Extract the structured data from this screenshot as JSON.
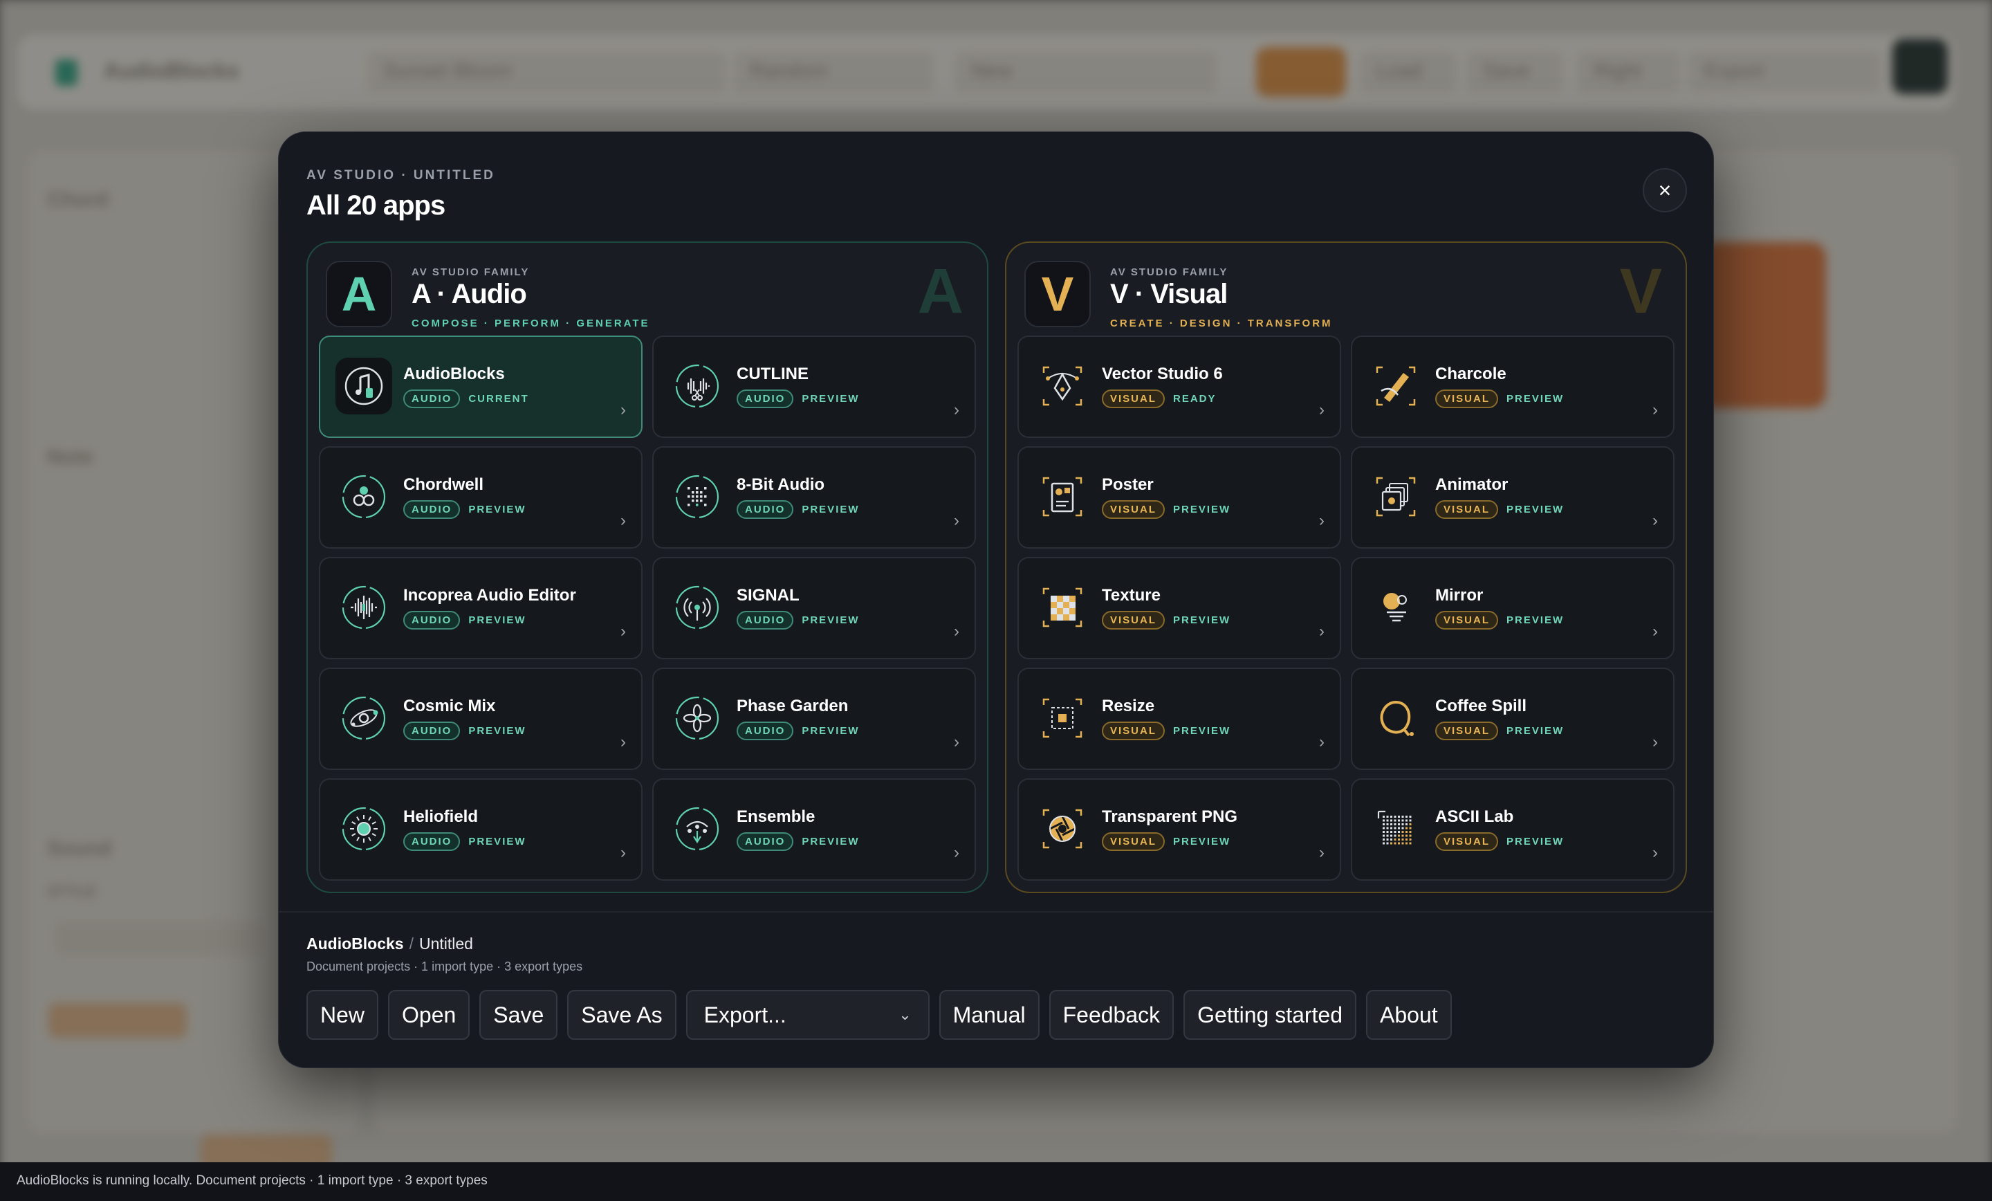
{
  "background": {
    "app_name": "AudioBlocks",
    "preset": "Sunset Bloom",
    "pills": [
      "Random",
      "New",
      "Play",
      "Load",
      "Save",
      "Right",
      "Export"
    ],
    "sections": [
      "Chord",
      "Note",
      "Sound",
      "STYLE",
      "Plays"
    ]
  },
  "status_bar": {
    "text": "AudioBlocks is running locally. Document projects · 1 import type · 3 export types"
  },
  "modal": {
    "eyebrow": "AV STUDIO · UNTITLED",
    "title": "All 20 apps",
    "close_label": "×"
  },
  "families": {
    "audio": {
      "mark": "A",
      "kicker": "AV STUDIO FAMILY",
      "name": "A · Audio",
      "tagline": "COMPOSE · PERFORM · GENERATE",
      "watermark": "A",
      "accent": "#5fd0b0",
      "apps": [
        {
          "name": "AudioBlocks",
          "badge": "AUDIO",
          "status": "CURRENT",
          "icon": "audioblocks-icon"
        },
        {
          "name": "CUTLINE",
          "badge": "AUDIO",
          "status": "PREVIEW",
          "icon": "waveform-scissors-icon"
        },
        {
          "name": "Chordwell",
          "badge": "AUDIO",
          "status": "PREVIEW",
          "icon": "chord-circles-icon"
        },
        {
          "name": "8-Bit Audio",
          "badge": "AUDIO",
          "status": "PREVIEW",
          "icon": "pixel-dots-icon"
        },
        {
          "name": "Incoprea Audio Editor",
          "badge": "AUDIO",
          "status": "PREVIEW",
          "icon": "waveform-icon"
        },
        {
          "name": "SIGNAL",
          "badge": "AUDIO",
          "status": "PREVIEW",
          "icon": "broadcast-icon"
        },
        {
          "name": "Cosmic Mix",
          "badge": "AUDIO",
          "status": "PREVIEW",
          "icon": "orbit-icon"
        },
        {
          "name": "Phase Garden",
          "badge": "AUDIO",
          "status": "PREVIEW",
          "icon": "flower-icon"
        },
        {
          "name": "Heliofield",
          "badge": "AUDIO",
          "status": "PREVIEW",
          "icon": "sun-icon"
        },
        {
          "name": "Ensemble",
          "badge": "AUDIO",
          "status": "PREVIEW",
          "icon": "ensemble-icon"
        }
      ]
    },
    "visual": {
      "mark": "V",
      "kicker": "AV STUDIO FAMILY",
      "name": "V · Visual",
      "tagline": "CREATE · DESIGN · TRANSFORM",
      "watermark": "V",
      "accent": "#e3b054",
      "apps": [
        {
          "name": "Vector Studio 6",
          "badge": "VISUAL",
          "status": "READY",
          "icon": "pen-nib-icon"
        },
        {
          "name": "Charcole",
          "badge": "VISUAL",
          "status": "PREVIEW",
          "icon": "charcoal-stick-icon"
        },
        {
          "name": "Poster",
          "badge": "VISUAL",
          "status": "PREVIEW",
          "icon": "poster-icon"
        },
        {
          "name": "Animator",
          "badge": "VISUAL",
          "status": "PREVIEW",
          "icon": "layers-icon"
        },
        {
          "name": "Texture",
          "badge": "VISUAL",
          "status": "PREVIEW",
          "icon": "checker-icon"
        },
        {
          "name": "Mirror",
          "badge": "VISUAL",
          "status": "PREVIEW",
          "icon": "mirror-icon"
        },
        {
          "name": "Resize",
          "badge": "VISUAL",
          "status": "PREVIEW",
          "icon": "resize-frame-icon"
        },
        {
          "name": "Coffee Spill",
          "badge": "VISUAL",
          "status": "PREVIEW",
          "icon": "spill-icon"
        },
        {
          "name": "Transparent PNG",
          "badge": "VISUAL",
          "status": "PREVIEW",
          "icon": "aperture-icon"
        },
        {
          "name": "ASCII Lab",
          "badge": "VISUAL",
          "status": "PREVIEW",
          "icon": "dot-grid-icon"
        }
      ]
    }
  },
  "footer": {
    "app": "AudioBlocks",
    "separator": "/",
    "document": "Untitled",
    "meta": "Document projects · 1 import type · 3 export types",
    "buttons": {
      "new": "New",
      "open": "Open",
      "save": "Save",
      "save_as": "Save As",
      "export": "Export...",
      "manual": "Manual",
      "feedback": "Feedback",
      "getting_started": "Getting started",
      "about": "About"
    }
  },
  "chevron": "›"
}
